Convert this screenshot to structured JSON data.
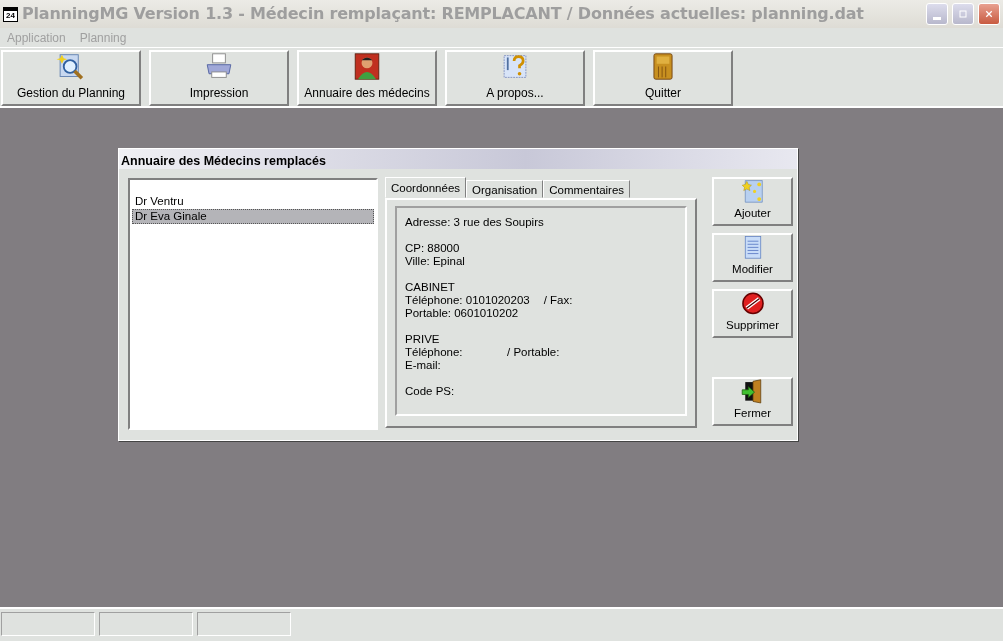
{
  "window": {
    "title": "PlanningMG Version 1.3 - Médecin remplaçant: REMPLACANT / Données actuelles: planning.dat",
    "app_icon_text": "24"
  },
  "menu": [
    {
      "label": "Application"
    },
    {
      "label": "Planning"
    }
  ],
  "toolbar": [
    {
      "label": "Gestion du Planning",
      "kind": "search"
    },
    {
      "label": "Impression",
      "kind": "printer"
    },
    {
      "label": "Annuaire des médecins",
      "kind": "person"
    },
    {
      "label": "A propos...",
      "kind": "help"
    },
    {
      "label": "Quitter",
      "kind": "door"
    }
  ],
  "dialog": {
    "title": "Annuaire des Médecins remplacés",
    "list": [
      {
        "label": "Dr Ventru",
        "selected": false
      },
      {
        "label": "Dr Eva Ginale",
        "selected": true
      }
    ],
    "tabs": [
      {
        "label": "Coordonnées",
        "selected": true
      },
      {
        "label": "Organisation",
        "selected": false
      },
      {
        "label": "Commentaires",
        "selected": false
      }
    ],
    "details": [
      [
        {
          "text": "Adresse: 3 rue des Soupirs"
        }
      ],
      [
        {
          "text": "CP: 88000"
        },
        {
          "text": "Ville: Epinal"
        }
      ],
      [
        {
          "text": "CABINET"
        },
        {
          "text": "Téléphone: 0101020203",
          "extra": "/ Fax:"
        },
        {
          "text": "Portable: 0601010202"
        }
      ],
      [
        {
          "text": "PRIVE"
        },
        {
          "text": "Téléphone:",
          "extra": "/ Portable:"
        },
        {
          "text": "E-mail:"
        }
      ],
      [
        {
          "text": "Code PS:"
        }
      ]
    ],
    "buttons": [
      {
        "label": "Ajouter",
        "kind": "stars"
      },
      {
        "label": "Modifier",
        "kind": "page"
      },
      {
        "label": "Supprimer",
        "kind": "forbidden"
      },
      {
        "label": "Fermer",
        "kind": "exit"
      }
    ]
  }
}
